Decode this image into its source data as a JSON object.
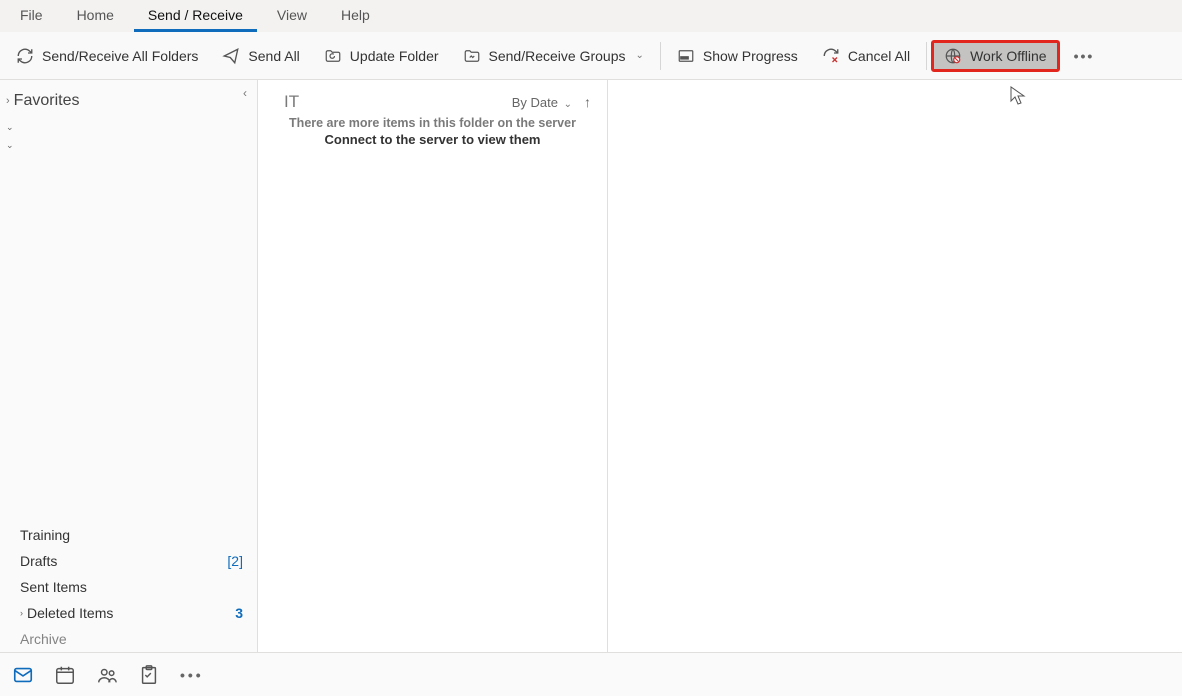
{
  "tabs": {
    "file": "File",
    "home": "Home",
    "send_receive": "Send / Receive",
    "view": "View",
    "help": "Help"
  },
  "ribbon": {
    "send_receive_all": "Send/Receive All Folders",
    "send_all": "Send All",
    "update_folder": "Update Folder",
    "send_receive_groups": "Send/Receive Groups",
    "show_progress": "Show Progress",
    "cancel_all": "Cancel All",
    "work_offline": "Work Offline"
  },
  "sidebar": {
    "favorites": "Favorites",
    "training": "Training",
    "drafts": {
      "label": "Drafts",
      "count": "[2]"
    },
    "sent_items": "Sent Items",
    "deleted_items": {
      "label": "Deleted Items",
      "count": "3"
    },
    "archive": "Archive"
  },
  "msglist": {
    "folder_name": "IT",
    "sort_label": "By Date",
    "banner1": "There are more items in this folder on the server",
    "banner2": "Connect to the server to view them"
  }
}
